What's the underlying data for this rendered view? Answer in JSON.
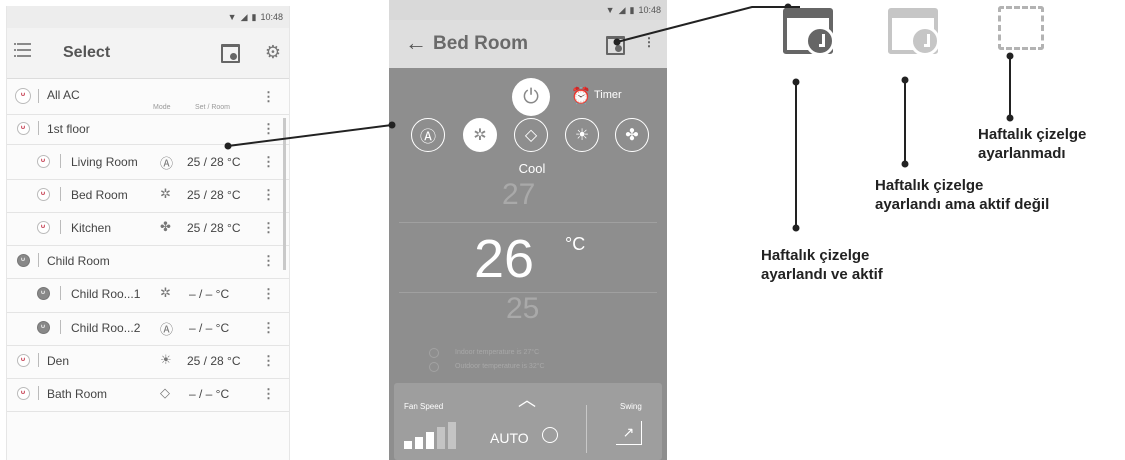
{
  "left_phone": {
    "status_time": "10:48",
    "title": "Select",
    "col_mode": "Mode",
    "col_set_room": "Set / Room",
    "rows": [
      {
        "name": "All AC",
        "mode": "",
        "temp": ""
      },
      {
        "name": "1st floor",
        "mode": "",
        "temp": ""
      },
      {
        "name": "Living Room",
        "mode": "Ⓐ",
        "temp": "25 / 28 °C"
      },
      {
        "name": "Bed Room",
        "mode": "✲",
        "temp": "25 / 28 °C"
      },
      {
        "name": "Kitchen",
        "mode": "✤",
        "temp": "25 / 28 °C"
      },
      {
        "name": "Child Room",
        "mode": "",
        "temp": ""
      },
      {
        "name": "Child Roo...1",
        "mode": "✲",
        "temp": "– / –  °C"
      },
      {
        "name": "Child Roo...2",
        "mode": "Ⓐ",
        "temp": "– / –  °C"
      },
      {
        "name": "Den",
        "mode": "☀",
        "temp": "25 / 28 °C"
      },
      {
        "name": "Bath Room",
        "mode": "◇",
        "temp": "– / –  °C"
      }
    ]
  },
  "right_phone": {
    "status_time": "10:48",
    "title": "Bed Room",
    "timer_label": "Timer",
    "mode_label": "Cool",
    "temp_up": "27",
    "temp_set": "26",
    "temp_unit": "°C",
    "temp_down": "25",
    "indoor_text": "Indoor temperature is  27°C",
    "outdoor_text": "Outdoor temperature is  32°C",
    "fan_speed_label": "Fan Speed",
    "fan_mode": "AUTO",
    "swing_label": "Swing"
  },
  "callouts": {
    "active": [
      "Haftalık çizelge",
      "ayarlandı ve aktif"
    ],
    "inactive": [
      "Haftalık çizelge",
      "ayarlandı ama aktif değil"
    ],
    "unset": [
      "Haftalık çizelge",
      "ayarlanmadı"
    ]
  },
  "colors": {
    "active_schedule": "#666666",
    "inactive_schedule": "#c6c6c6",
    "unset_schedule": "#b3b3b3",
    "detail_bg": "#8e8e8e"
  }
}
